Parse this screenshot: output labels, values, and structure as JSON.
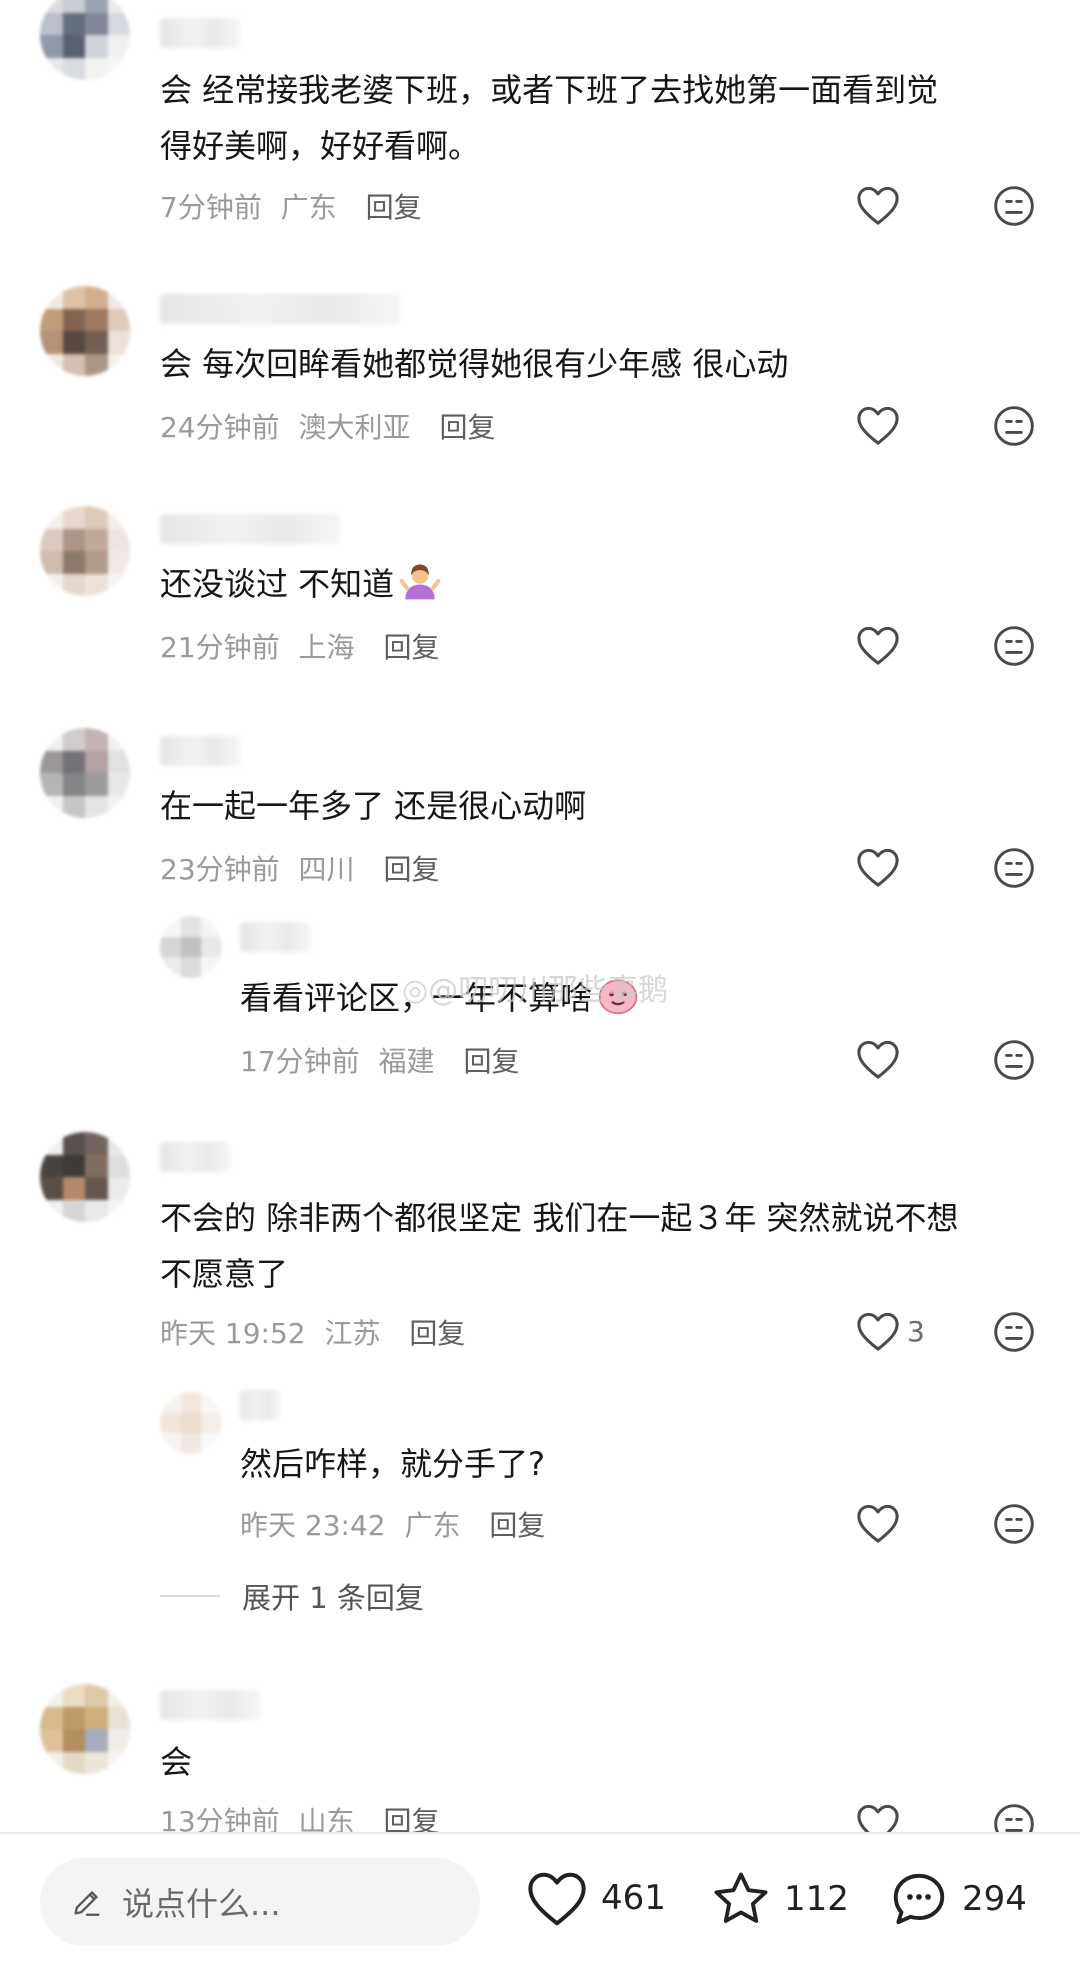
{
  "colors": {
    "text": "#161616",
    "meta": "#9a9a9a",
    "reply": "#5e5e5e",
    "icon": "#4a4a4a"
  },
  "comments": [
    {
      "line1": "会 经常接我老婆下班，或者下班了去找她第一面看到觉",
      "line2": "得好美啊，好好看啊。",
      "time": "7分钟前",
      "location": "广东",
      "reply_label": "回复"
    },
    {
      "line1": "会 每次回眸看她都觉得她很有少年感 很心动",
      "time": "24分钟前",
      "location": "澳大利亚",
      "reply_label": "回复"
    },
    {
      "line1": "还没谈过 不知道",
      "emoji": "shrugging-woman-emoji",
      "time": "21分钟前",
      "location": "上海",
      "reply_label": "回复"
    },
    {
      "line1": "在一起一年多了 还是很心动啊",
      "time": "23分钟前",
      "location": "四川",
      "reply_label": "回复"
    },
    {
      "line1": "看看评论区，一年不算啥",
      "emoji": "pink-character-emoji",
      "time": "17分钟前",
      "location": "福建",
      "reply_label": "回复"
    },
    {
      "line1": "不会的 除非两个都很坚定 我们在一起３年 突然就说不想",
      "line2": "不愿意了",
      "time": "昨天 19:52",
      "location": "江苏",
      "reply_label": "回复",
      "likes": "3"
    },
    {
      "line1": "然后咋样，就分手了?",
      "time": "昨天 23:42",
      "location": "广东",
      "reply_label": "回复"
    },
    {
      "line1": "会",
      "time": "13分钟前",
      "location": "山东",
      "reply_label": "回复"
    }
  ],
  "expand_replies": "展开 1 条回复",
  "watermark": "@叨叨川那些事鹅",
  "bottom_bar": {
    "input_placeholder": "说点什么...",
    "likes": "461",
    "favorites": "112",
    "comments": "294"
  }
}
